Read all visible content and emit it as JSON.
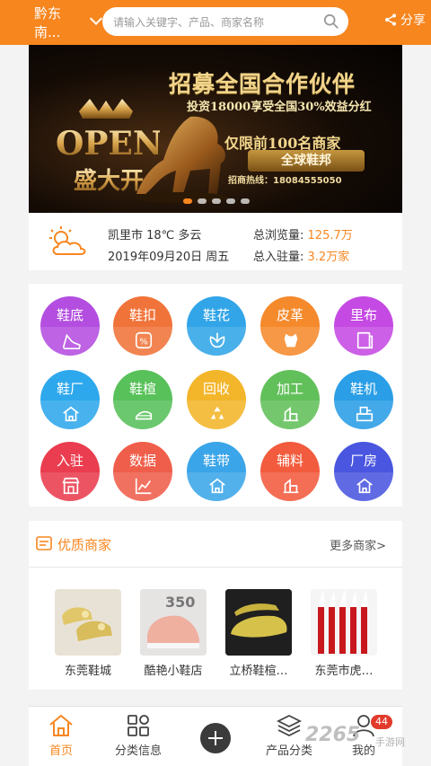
{
  "header": {
    "city": "黔东南...",
    "search_placeholder": "请输入关键字、产品、商家名称",
    "share_label": "分享"
  },
  "banner": {
    "logo_text": "OPEN",
    "logo_sub": "盛大开",
    "title": "招募全国合作伙伴",
    "subtitle": "投资18000享受全国30%效益分红",
    "offer": "仅限前100名商家",
    "slogan": "全球鞋邦",
    "hotline": "招商热线：18084555050",
    "dots": 5,
    "active_dot": 1
  },
  "info": {
    "weather": "凯里市 18℃ 多云",
    "date": "2019年09月20日 周五",
    "views_label": "总浏览量:",
    "views_value": "125.7万",
    "resident_label": "总入驻量:",
    "resident_value": "3.2万家"
  },
  "categories": [
    {
      "label": "鞋底",
      "icon": "shoe-icon",
      "color": "#b44ee0"
    },
    {
      "label": "鞋扣",
      "icon": "buckle-icon",
      "color": "#f0743a"
    },
    {
      "label": "鞋花",
      "icon": "flower-icon",
      "color": "#32a5e8"
    },
    {
      "label": "皮革",
      "icon": "leather-icon",
      "color": "#f58a2c"
    },
    {
      "label": "里布",
      "icon": "fabric-icon",
      "color": "#c54ae3"
    },
    {
      "label": "鞋厂",
      "icon": "home-icon",
      "color": "#2ea8ec"
    },
    {
      "label": "鞋楦",
      "icon": "last-icon",
      "color": "#58c15a"
    },
    {
      "label": "回收",
      "icon": "recycle-icon",
      "color": "#f3b52a"
    },
    {
      "label": "加工",
      "icon": "building-icon",
      "color": "#62c05a"
    },
    {
      "label": "鞋机",
      "icon": "machine-icon",
      "color": "#2a9ee6"
    },
    {
      "label": "入驻",
      "icon": "shop-icon",
      "color": "#ea3d4f"
    },
    {
      "label": "数据",
      "icon": "chart-icon",
      "color": "#ef5e4a"
    },
    {
      "label": "鞋带",
      "icon": "home-icon",
      "color": "#3ba5e9"
    },
    {
      "label": "辅料",
      "icon": "building-icon",
      "color": "#f25b3d"
    },
    {
      "label": "厂房",
      "icon": "home-icon",
      "color": "#4a56e0"
    }
  ],
  "merchants": {
    "title": "优质商家",
    "more": "更多商家>",
    "items": [
      {
        "name": "东莞鞋城"
      },
      {
        "name": "酷艳小鞋店"
      },
      {
        "name": "立桥鞋楦…"
      },
      {
        "name": "东莞市虎…"
      }
    ]
  },
  "bottom_nav": [
    {
      "label": "首页",
      "icon": "home-icon"
    },
    {
      "label": "分类信息",
      "icon": "grid-icon"
    },
    {
      "label": "产品分类",
      "icon": "layers-icon"
    },
    {
      "label": "我的",
      "icon": "user-icon"
    }
  ],
  "badge": "44",
  "watermark": {
    "main": "2265",
    "sub": "手游网"
  }
}
